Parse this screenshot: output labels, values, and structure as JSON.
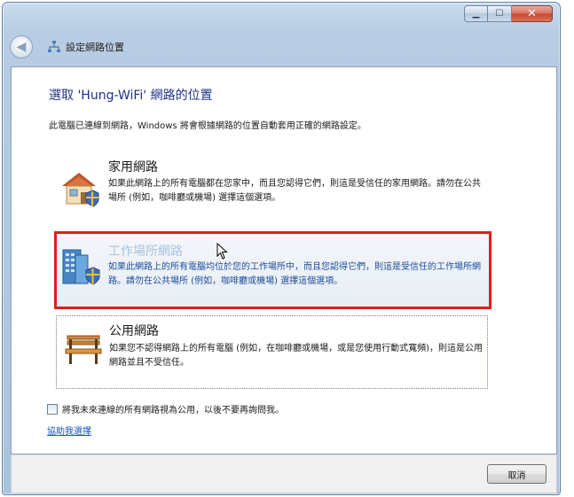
{
  "window": {
    "minimize_icon": "minimize-icon",
    "maximize_icon": "maximize-icon",
    "close_icon": "close-icon"
  },
  "nav": {
    "title": "設定網路位置",
    "back_icon": "back-arrow-icon",
    "network_icon": "network-icon"
  },
  "main": {
    "heading": "選取 'Hung-WiFi' 網路的位置",
    "description": "此電腦已連線到網路，Windows 將會根據網路的位置自動套用正確的網路設定。",
    "options": [
      {
        "title": "家用網路",
        "desc": "如果此網路上的所有電腦都在您家中，而且您認得它們，則這是受信任的家用網路。請勿在公共場所 (例如，咖啡廳或機場) 選擇這個選項。",
        "icon": "home-network-icon"
      },
      {
        "title": "工作場所網路",
        "desc": "如果此網路上的所有電腦均位於您的工作場所中，而且您認得它們，則這是受信任的工作場所網路。請勿在公共場所 (例如，咖啡廳或機場) 選擇這個選項。",
        "icon": "work-network-icon"
      },
      {
        "title": "公用網路",
        "desc": "如果您不認得網路上的所有電腦 (例如，在咖啡廳或機場，或是您使用行動式寬頻)，則這是公用網路並且不受信任。",
        "icon": "public-network-icon"
      }
    ],
    "checkbox_label": "將我未來連線的所有網路視為公用，以後不要再詢問我。",
    "checkbox_checked": false,
    "help_link": "協助我選擇"
  },
  "footer": {
    "cancel_label": "取消"
  },
  "colors": {
    "heading": "#1e3287",
    "link": "#1b56b5",
    "highlight_border": "#e01e1e"
  }
}
